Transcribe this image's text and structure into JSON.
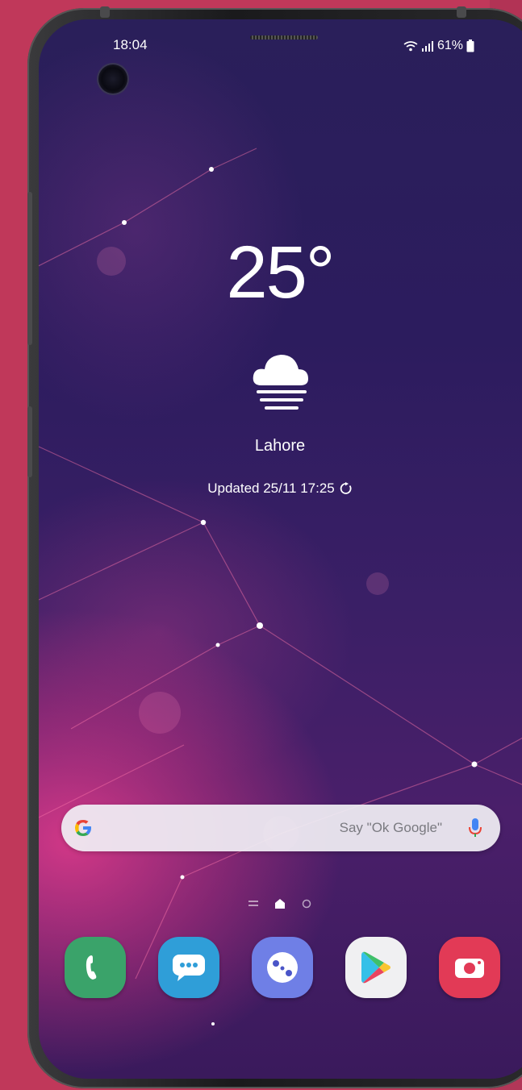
{
  "status_bar": {
    "time": "18:04",
    "battery": "61%",
    "icons": [
      "wifi-icon",
      "signal-icon",
      "battery-icon"
    ]
  },
  "weather": {
    "temperature": "25°",
    "condition_icon": "cloud-fog-icon",
    "city": "Lahore",
    "updated": "Updated 25/11 17:25"
  },
  "search": {
    "provider_icon": "google-g-icon",
    "hint": "Say \"Ok Google\"",
    "mic_icon": "mic-icon"
  },
  "page_indicator": [
    "menu-lines-icon",
    "home-icon",
    "page-dot-icon"
  ],
  "dock": [
    {
      "name": "phone-app",
      "icon": "phone-icon",
      "color": "#3aa36a"
    },
    {
      "name": "messages-app",
      "icon": "message-bubble-icon",
      "color": "#2f9ed8"
    },
    {
      "name": "samsung-connect-app",
      "icon": "connect-icon",
      "color": "#6f7fe6"
    },
    {
      "name": "play-store-app",
      "icon": "play-store-icon",
      "color": "#f0f0f2"
    },
    {
      "name": "camera-app",
      "icon": "camera-icon",
      "color": "#e23a56"
    }
  ],
  "colors": {
    "background": "#c0385a",
    "search_bar": "#f0eef4"
  }
}
